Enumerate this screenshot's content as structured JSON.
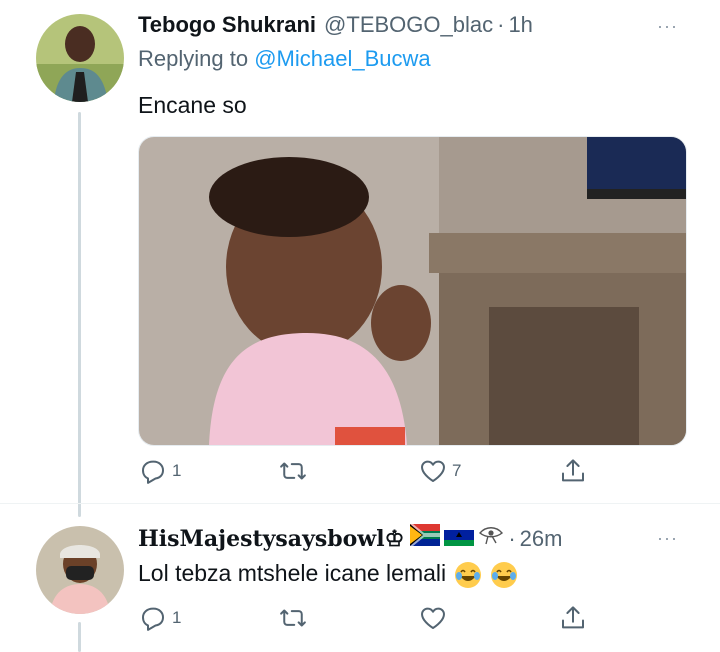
{
  "tweet1": {
    "display_name": "Tebogo Shukrani",
    "handle": "@TEBOGO_blac",
    "separator": "·",
    "time": "1h",
    "replying_prefix": "Replying to",
    "replying_to": "@Michael_Bucwa",
    "text": "Encane so",
    "reply_count": "1",
    "retweet_count": "",
    "like_count": "7",
    "more": "···"
  },
  "tweet2": {
    "display_name": "HisMajestysaysbowl♔",
    "separator": "·",
    "time": "26m",
    "text": "Lol tebza mtshele icane lemali",
    "reply_count": "1",
    "retweet_count": "",
    "like_count": "",
    "more": "···"
  },
  "icons": {
    "reply": "reply-icon",
    "retweet": "retweet-icon",
    "like": "heart-icon",
    "share": "share-icon"
  },
  "colors": {
    "link": "#1d9bf0",
    "muted": "#536471",
    "thread_line": "#cfd9de"
  }
}
